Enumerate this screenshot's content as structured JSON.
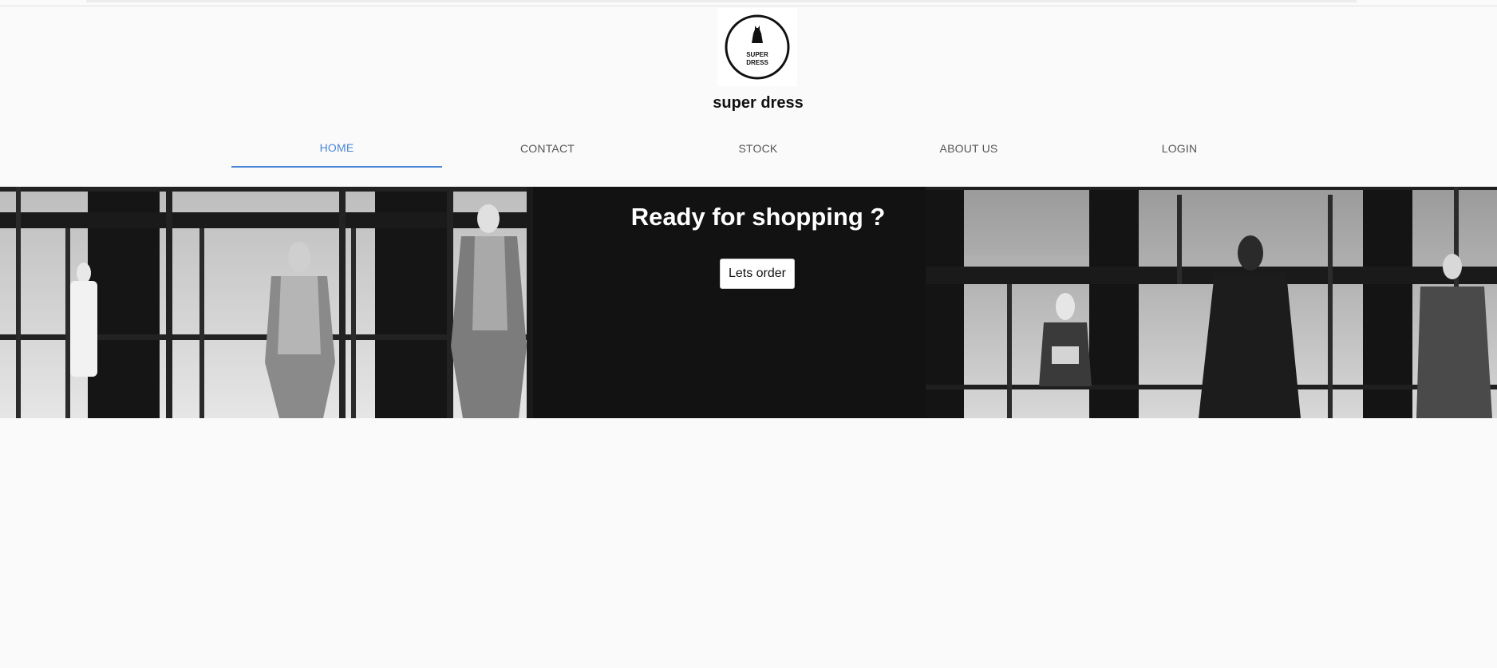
{
  "brand": {
    "logo_text_line1": "SUPER",
    "logo_text_line2": "DRESS",
    "logo_icon": "dress-icon",
    "site_title": "super dress"
  },
  "nav": {
    "tabs": [
      {
        "label": "HOME",
        "active": true
      },
      {
        "label": "CONTACT",
        "active": false
      },
      {
        "label": "STOCK",
        "active": false
      },
      {
        "label": "ABOUT US",
        "active": false
      },
      {
        "label": "LOGIN",
        "active": false
      }
    ]
  },
  "hero": {
    "title": "Ready for shopping ?",
    "button_label": "Lets order"
  },
  "colors": {
    "accent": "#4a86d6",
    "page_bg": "#fafafa",
    "hero_bg": "#121212"
  }
}
